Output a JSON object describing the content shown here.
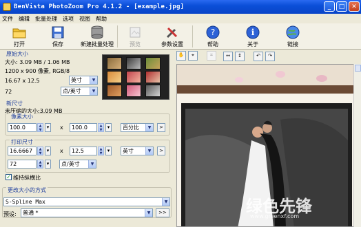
{
  "window": {
    "title": "BenVista PhotoZoom Pro 4.1.2 - [example.jpg]",
    "min": "_",
    "max": "□",
    "close": "✕"
  },
  "menu": [
    "文件",
    "编辑",
    "批量处理",
    "选项",
    "视图",
    "帮助"
  ],
  "toolbar": {
    "open": "打开",
    "save": "保存",
    "batch": "新建批量处理",
    "preview": "预览",
    "settings": "参数设置",
    "help": "帮助",
    "about": "关于",
    "link": "链接"
  },
  "original": {
    "title": "原始大小",
    "size": "大小: 3.09 MB / 1.06 MB",
    "pixels": "1200 x 900 像素, RGB/8",
    "print": "16.67 x 12.5",
    "unit1": "英寸",
    "dpi": "72",
    "unit2": "点/英寸"
  },
  "newsize": {
    "title": "新尺寸",
    "uncompressed": "未压缩的大小:3.09 MB",
    "pixel_title": "像素大小",
    "w": "100.0",
    "h": "100.0",
    "pxunit": "百分比",
    "print_title": "打印尺寸",
    "pw": "16.6667",
    "ph": "12.5",
    "punit": "英寸",
    "res": "72",
    "resunit": "点/英寸",
    "x": "x",
    "keep": "维持纵横比",
    "more": ">"
  },
  "method": {
    "title": "更改大小的方式",
    "value": "S-Spline Max",
    "preset_label": "预设:",
    "preset": "普通 *",
    "more": ">>"
  },
  "watermark": {
    "name": "绿色先锋",
    "url": "www.greenxf.com"
  }
}
